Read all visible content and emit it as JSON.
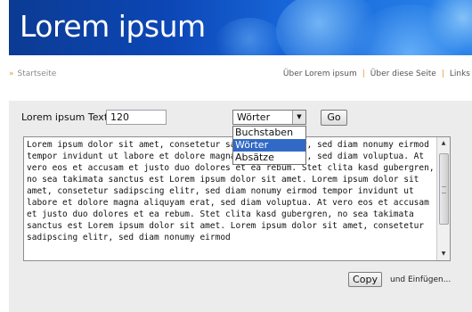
{
  "header": {
    "title": "Lorem ipsum"
  },
  "nav": {
    "home": "Startseite",
    "links": [
      "Über Lorem ipsum",
      "Über diese Seite",
      "Links"
    ]
  },
  "generator": {
    "label": "Lorem ipsum Text generieren",
    "count_value": "120",
    "unit_selected": "Wörter",
    "unit_options": [
      "Buchstaben",
      "Wörter",
      "Absätze"
    ],
    "go_label": "Go"
  },
  "output": {
    "text": "Lorem ipsum dolor sit amet, consetetur sadipscing elitr, sed diam nonumy eirmod tempor invidunt ut labore et dolore magna aliquyam erat, sed diam voluptua. At vero eos et accusam et justo duo dolores et ea rebum. Stet clita kasd gubergren, no sea takimata sanctus est Lorem ipsum dolor sit amet. Lorem ipsum dolor sit amet, consetetur sadipscing elitr, sed diam nonumy eirmod tempor invidunt ut labore et dolore magna aliquyam erat, sed diam voluptua. At vero eos et accusam et justo duo dolores et ea rebum. Stet clita kasd gubergren, no sea takimata sanctus est Lorem ipsum dolor sit amet. Lorem ipsum dolor sit amet, consetetur sadipscing elitr, sed diam nonumy eirmod"
  },
  "actions": {
    "copy_label": "Copy",
    "insert_label": "und Einfügen..."
  },
  "colors": {
    "accent": "#e09a2e",
    "highlight": "#3169c6"
  }
}
